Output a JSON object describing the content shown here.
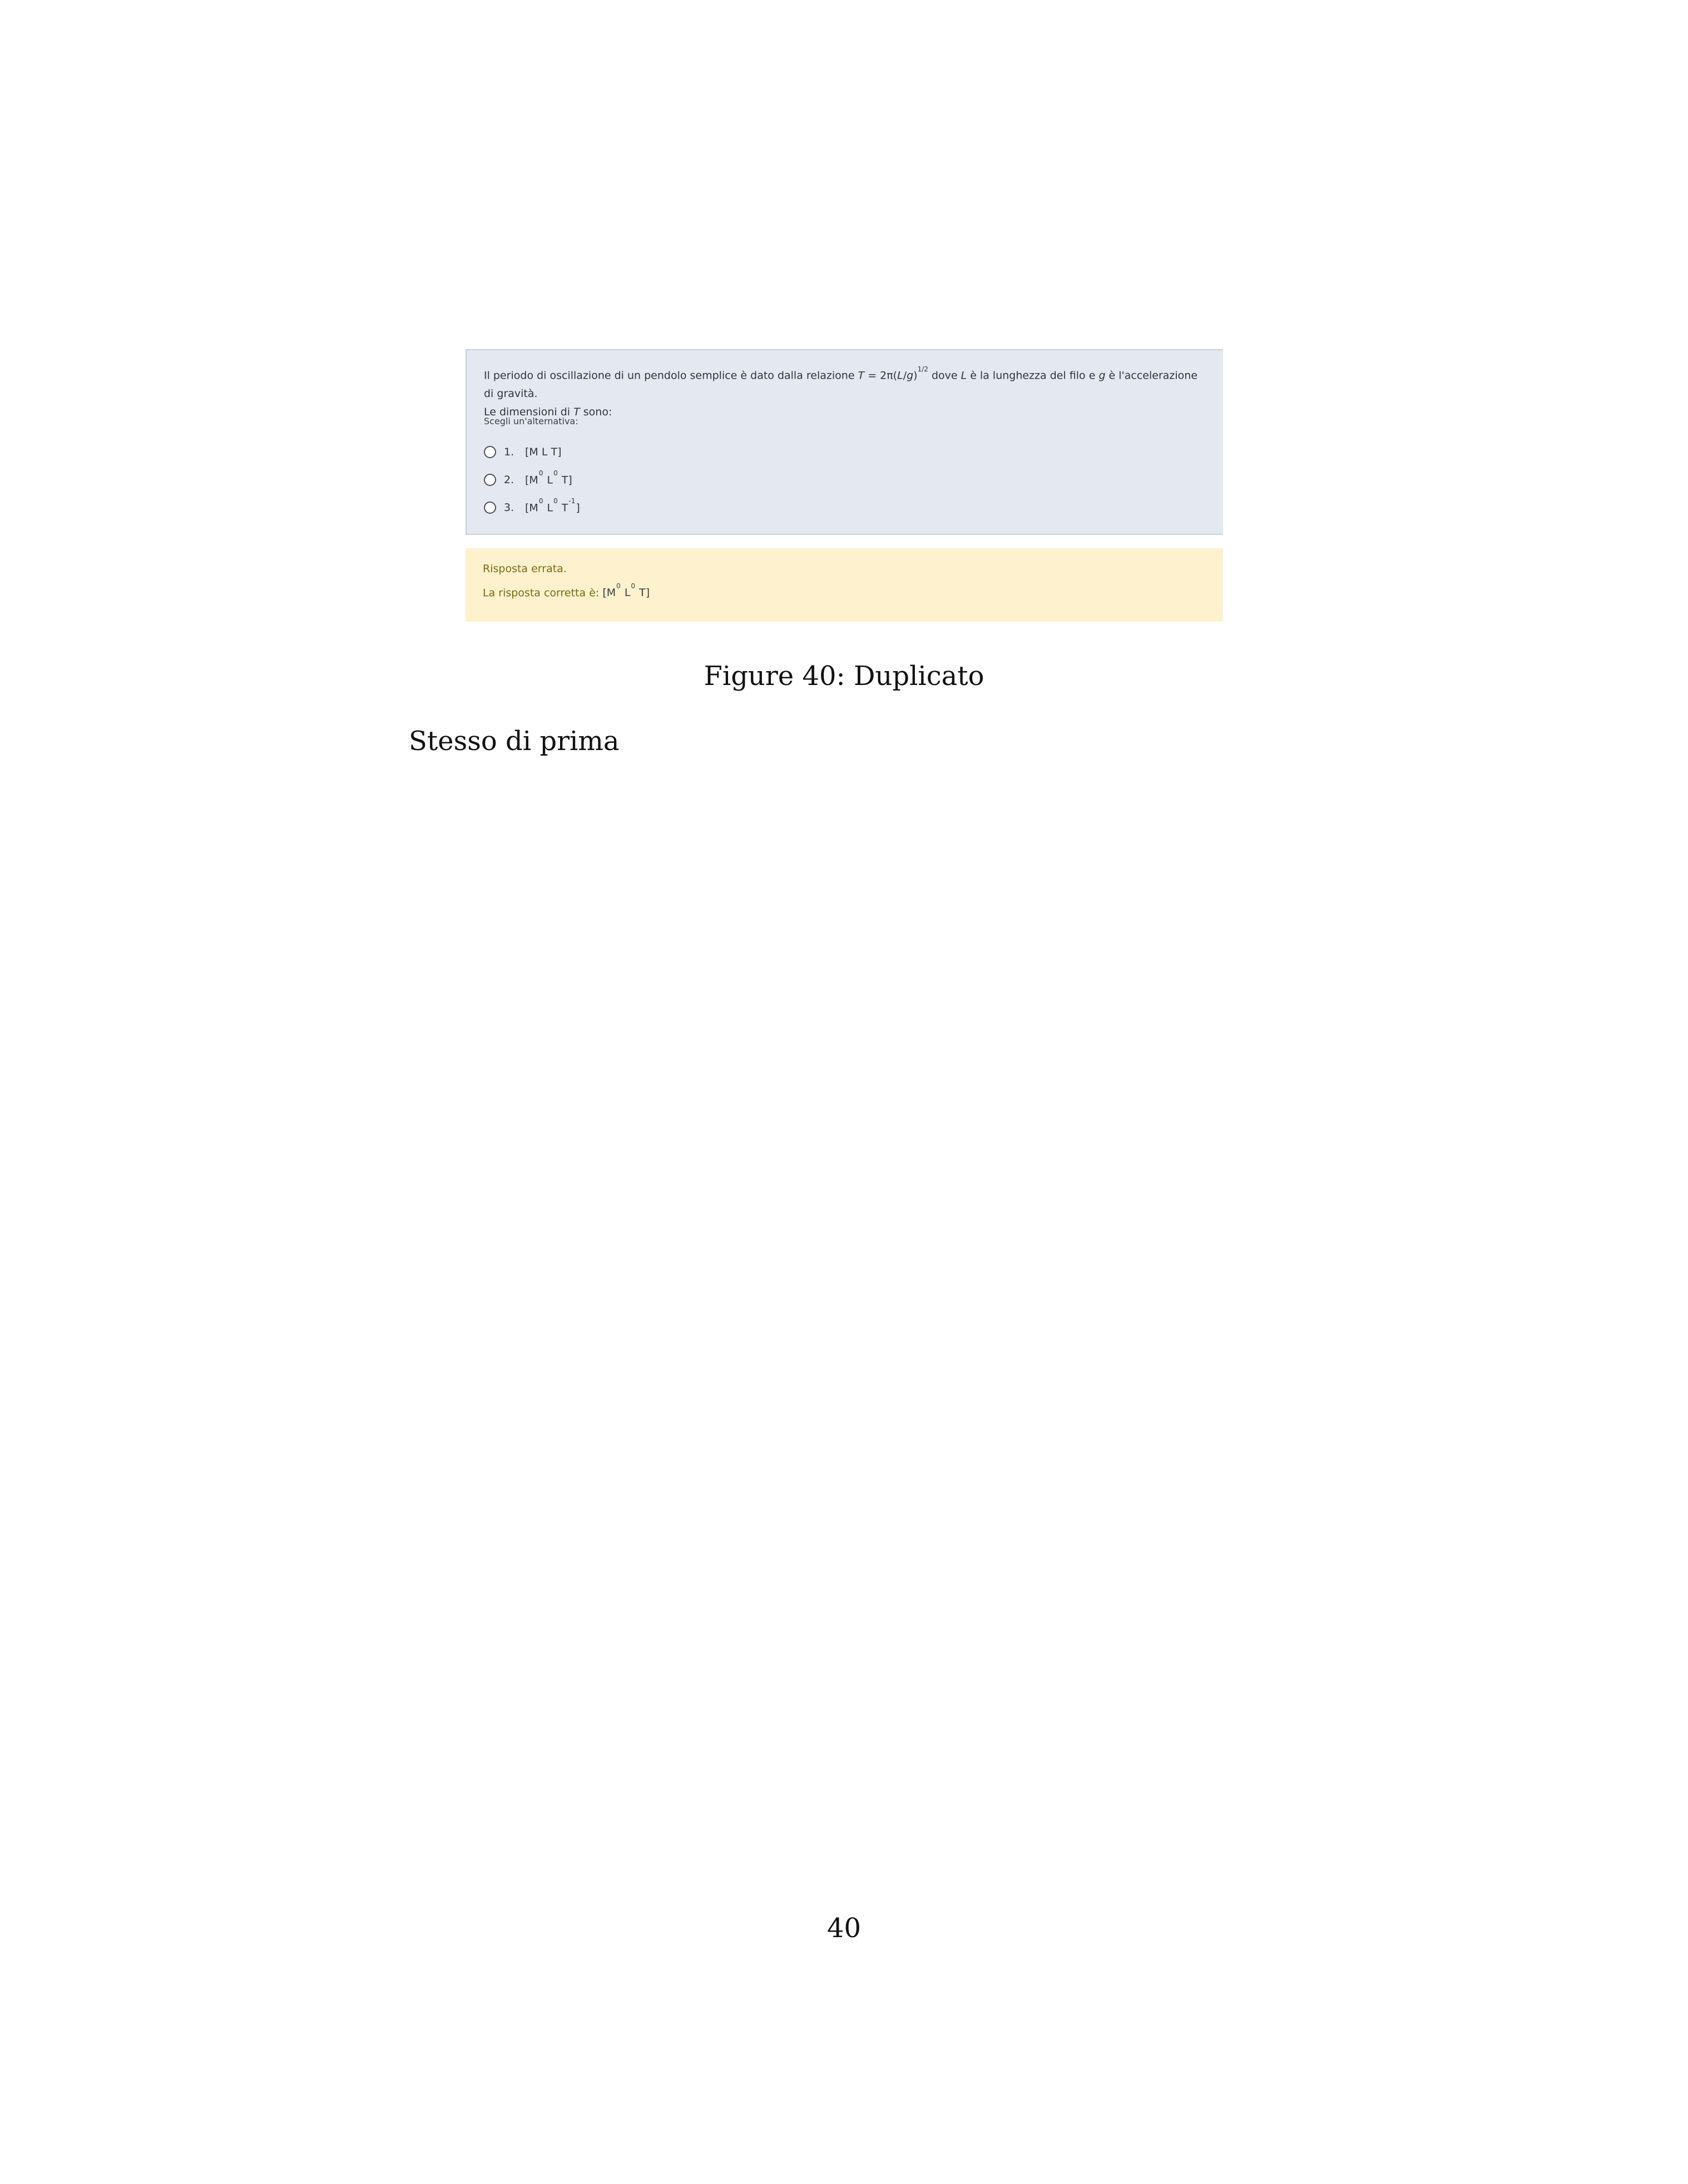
{
  "question": {
    "text_part1": "Il periodo di oscillazione di un pendolo semplice è dato dalla relazione ",
    "formula_T": "T",
    "formula_mid": " = 2π(",
    "formula_L": "L",
    "formula_slash": "/",
    "formula_g": "g",
    "formula_close": ")",
    "formula_exp": "1/2",
    "text_part2": " dove ",
    "var_L": "L",
    "text_part3": " è la lunghezza del filo e ",
    "var_g": "g",
    "text_part4": " è l'accelerazione di gravità.",
    "line2_part1": "Le dimensioni di ",
    "line2_T": "T",
    "line2_part2": " sono:",
    "choose_label": "Scegli un'alternativa:"
  },
  "options": [
    {
      "number": "1.",
      "base": "[M L T]",
      "parts": []
    },
    {
      "number": "2.",
      "parts": [
        {
          "t": "[M"
        },
        {
          "s": "0"
        },
        {
          "t": " L"
        },
        {
          "s": "0"
        },
        {
          "t": " T]"
        }
      ]
    },
    {
      "number": "3.",
      "parts": [
        {
          "t": "[M"
        },
        {
          "s": "0"
        },
        {
          "t": " L"
        },
        {
          "s": "0"
        },
        {
          "t": " T"
        },
        {
          "s": "-1"
        },
        {
          "t": "]"
        }
      ]
    }
  ],
  "option1_label": "[M L T]",
  "option2": {
    "a": "[M",
    "e1": "0",
    "b": " L",
    "e2": "0",
    "c": " T]"
  },
  "option3": {
    "a": "[M",
    "e1": "0",
    "b": " L",
    "e2": "0",
    "c": " T",
    "e3": "-1",
    "d": "]"
  },
  "feedback": {
    "status": "Risposta errata.",
    "correct_prefix": "La risposta corretta è: ",
    "answer_a": "[M",
    "answer_e1": "0",
    "answer_b": " L",
    "answer_e2": "0",
    "answer_c": " T]"
  },
  "caption": "Figure 40: Duplicato",
  "body_text": "Stesso di prima",
  "page_number": "40",
  "colors": {
    "question_bg": "#e4e8f1",
    "feedback_bg": "#fef1cd",
    "feedback_text": "#7a6a10"
  }
}
